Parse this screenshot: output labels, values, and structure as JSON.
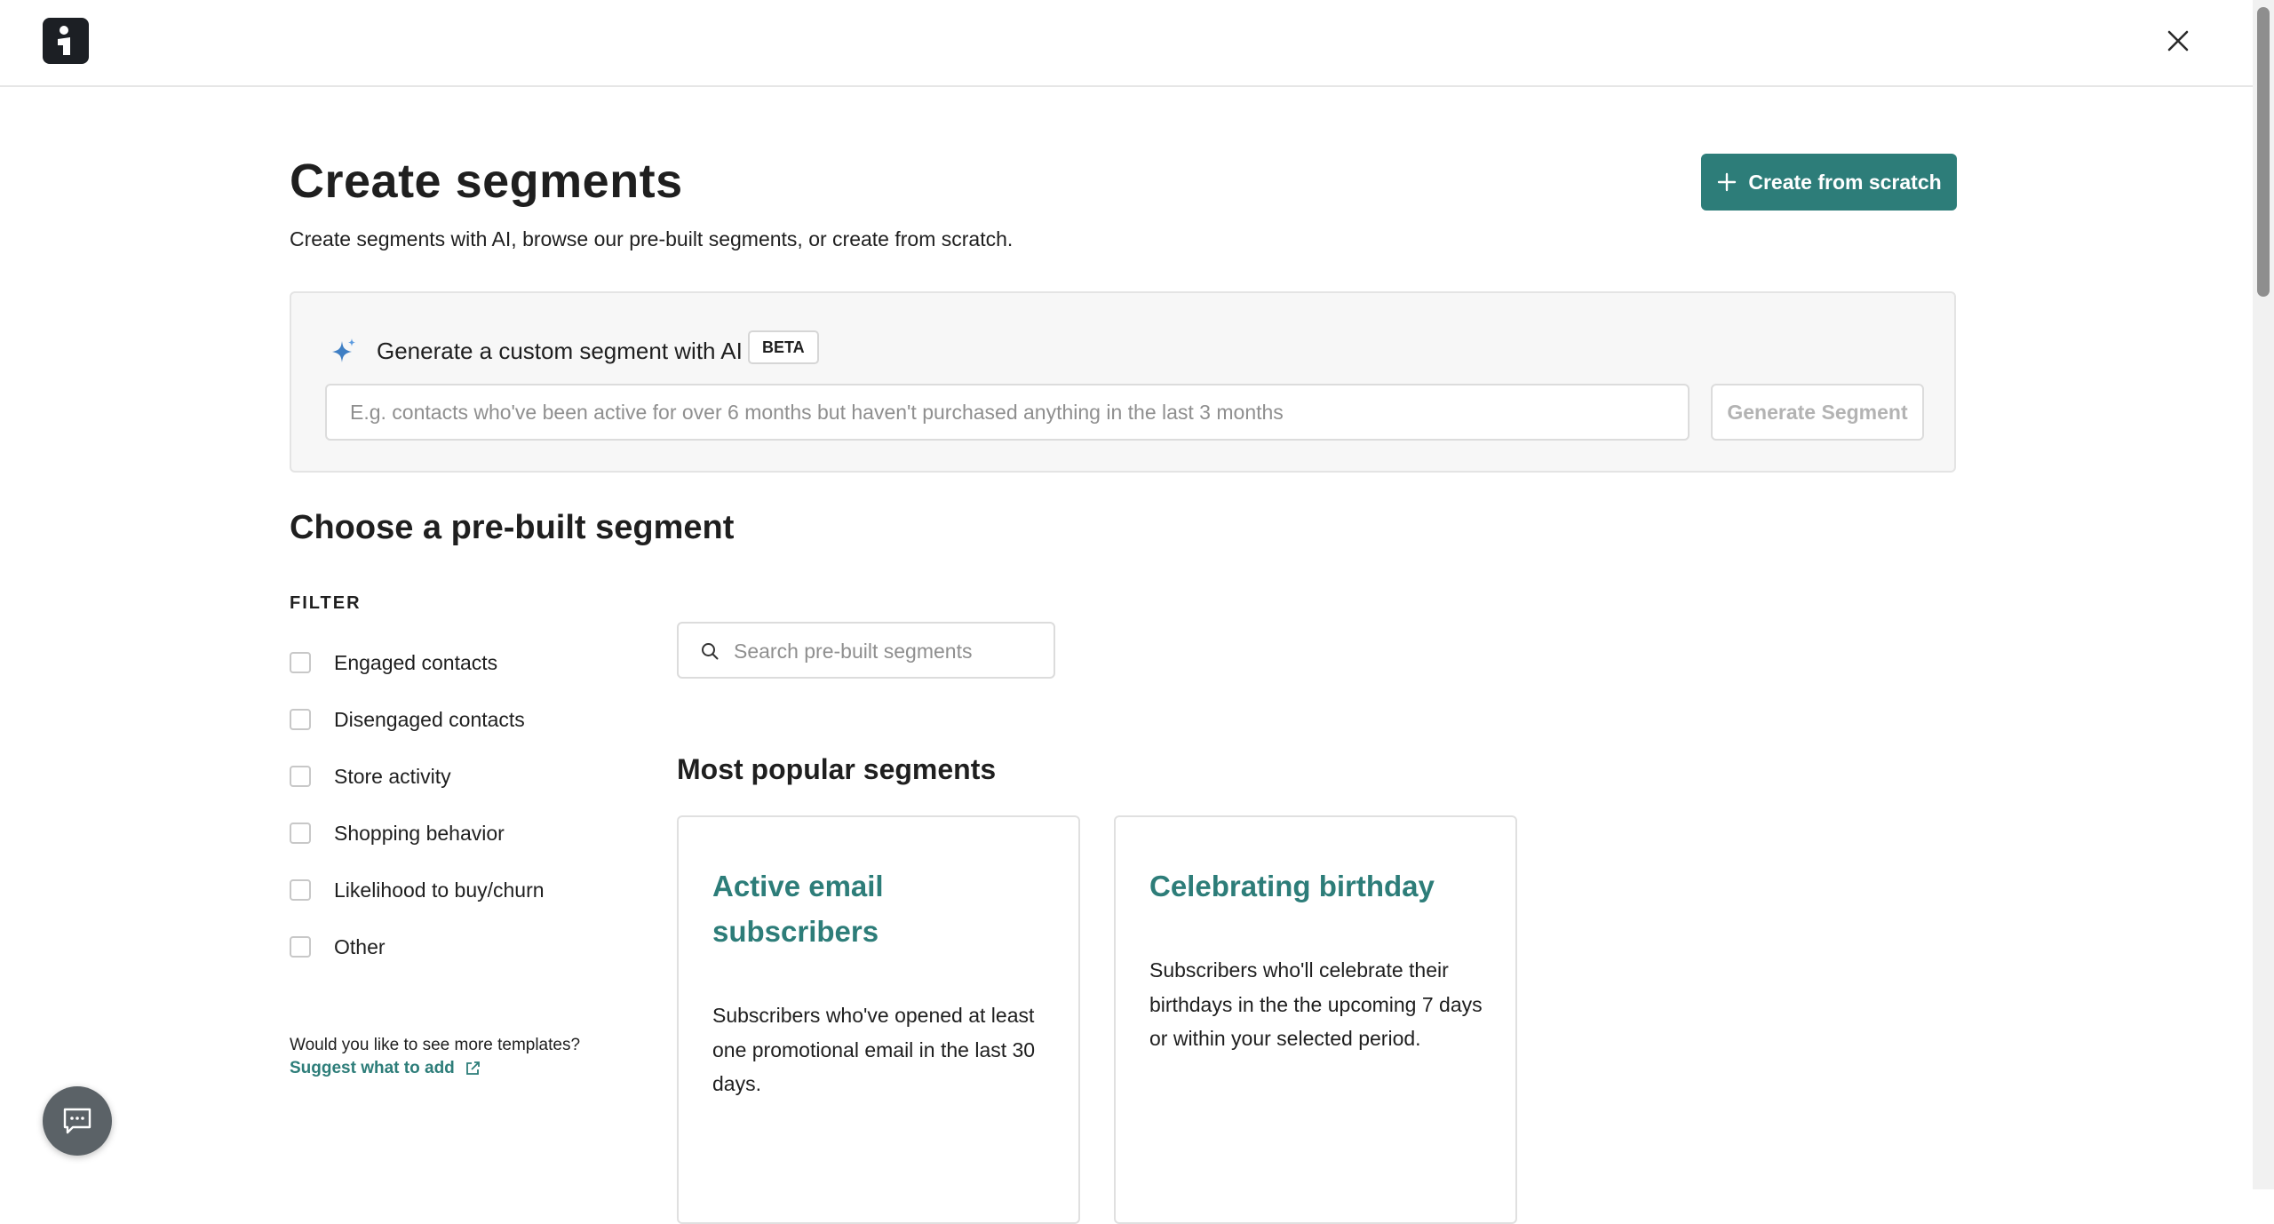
{
  "header": {
    "logo_icon": "brand-logo-icon",
    "close_icon": "close-icon"
  },
  "page": {
    "title": "Create segments",
    "subtitle": "Create segments with AI, browse our pre-built segments, or create from scratch.",
    "create_button_label": "Create from scratch",
    "create_button_icon": "plus-icon"
  },
  "ai_generator": {
    "icon": "sparkle-icon",
    "title": "Generate a custom segment with AI",
    "badge": "BETA",
    "placeholder": "E.g. contacts who've been active for over 6 months but haven't purchased anything in the last 3 months",
    "value": "",
    "button_label": "Generate Segment"
  },
  "prebuilt": {
    "title": "Choose a pre-built segment",
    "filter_label": "FILTER",
    "filters": [
      {
        "label": "Engaged contacts",
        "checked": false
      },
      {
        "label": "Disengaged contacts",
        "checked": false
      },
      {
        "label": "Store activity",
        "checked": false
      },
      {
        "label": "Shopping behavior",
        "checked": false
      },
      {
        "label": "Likelihood to buy/churn",
        "checked": false
      },
      {
        "label": "Other",
        "checked": false
      }
    ],
    "more_templates_question": "Would you like to see more templates?",
    "suggest_link": "Suggest what to add",
    "search_placeholder": "Search pre-built segments",
    "search_value": "",
    "popular_title": "Most popular segments",
    "cards": [
      {
        "title": "Active email subscribers",
        "description": "Subscribers who've opened at least one promotional email in the last 30 days."
      },
      {
        "title": "Celebrating birthday",
        "description": "Subscribers who'll celebrate their birthdays in the the upcoming 7 days or within your selected period."
      }
    ]
  },
  "colors": {
    "accent": "#2d7d79",
    "text": "#1f1f1f",
    "border": "#e0e0e0",
    "panel_bg": "#f7f7f7"
  },
  "chat_widget": {
    "icon": "chat-icon"
  }
}
